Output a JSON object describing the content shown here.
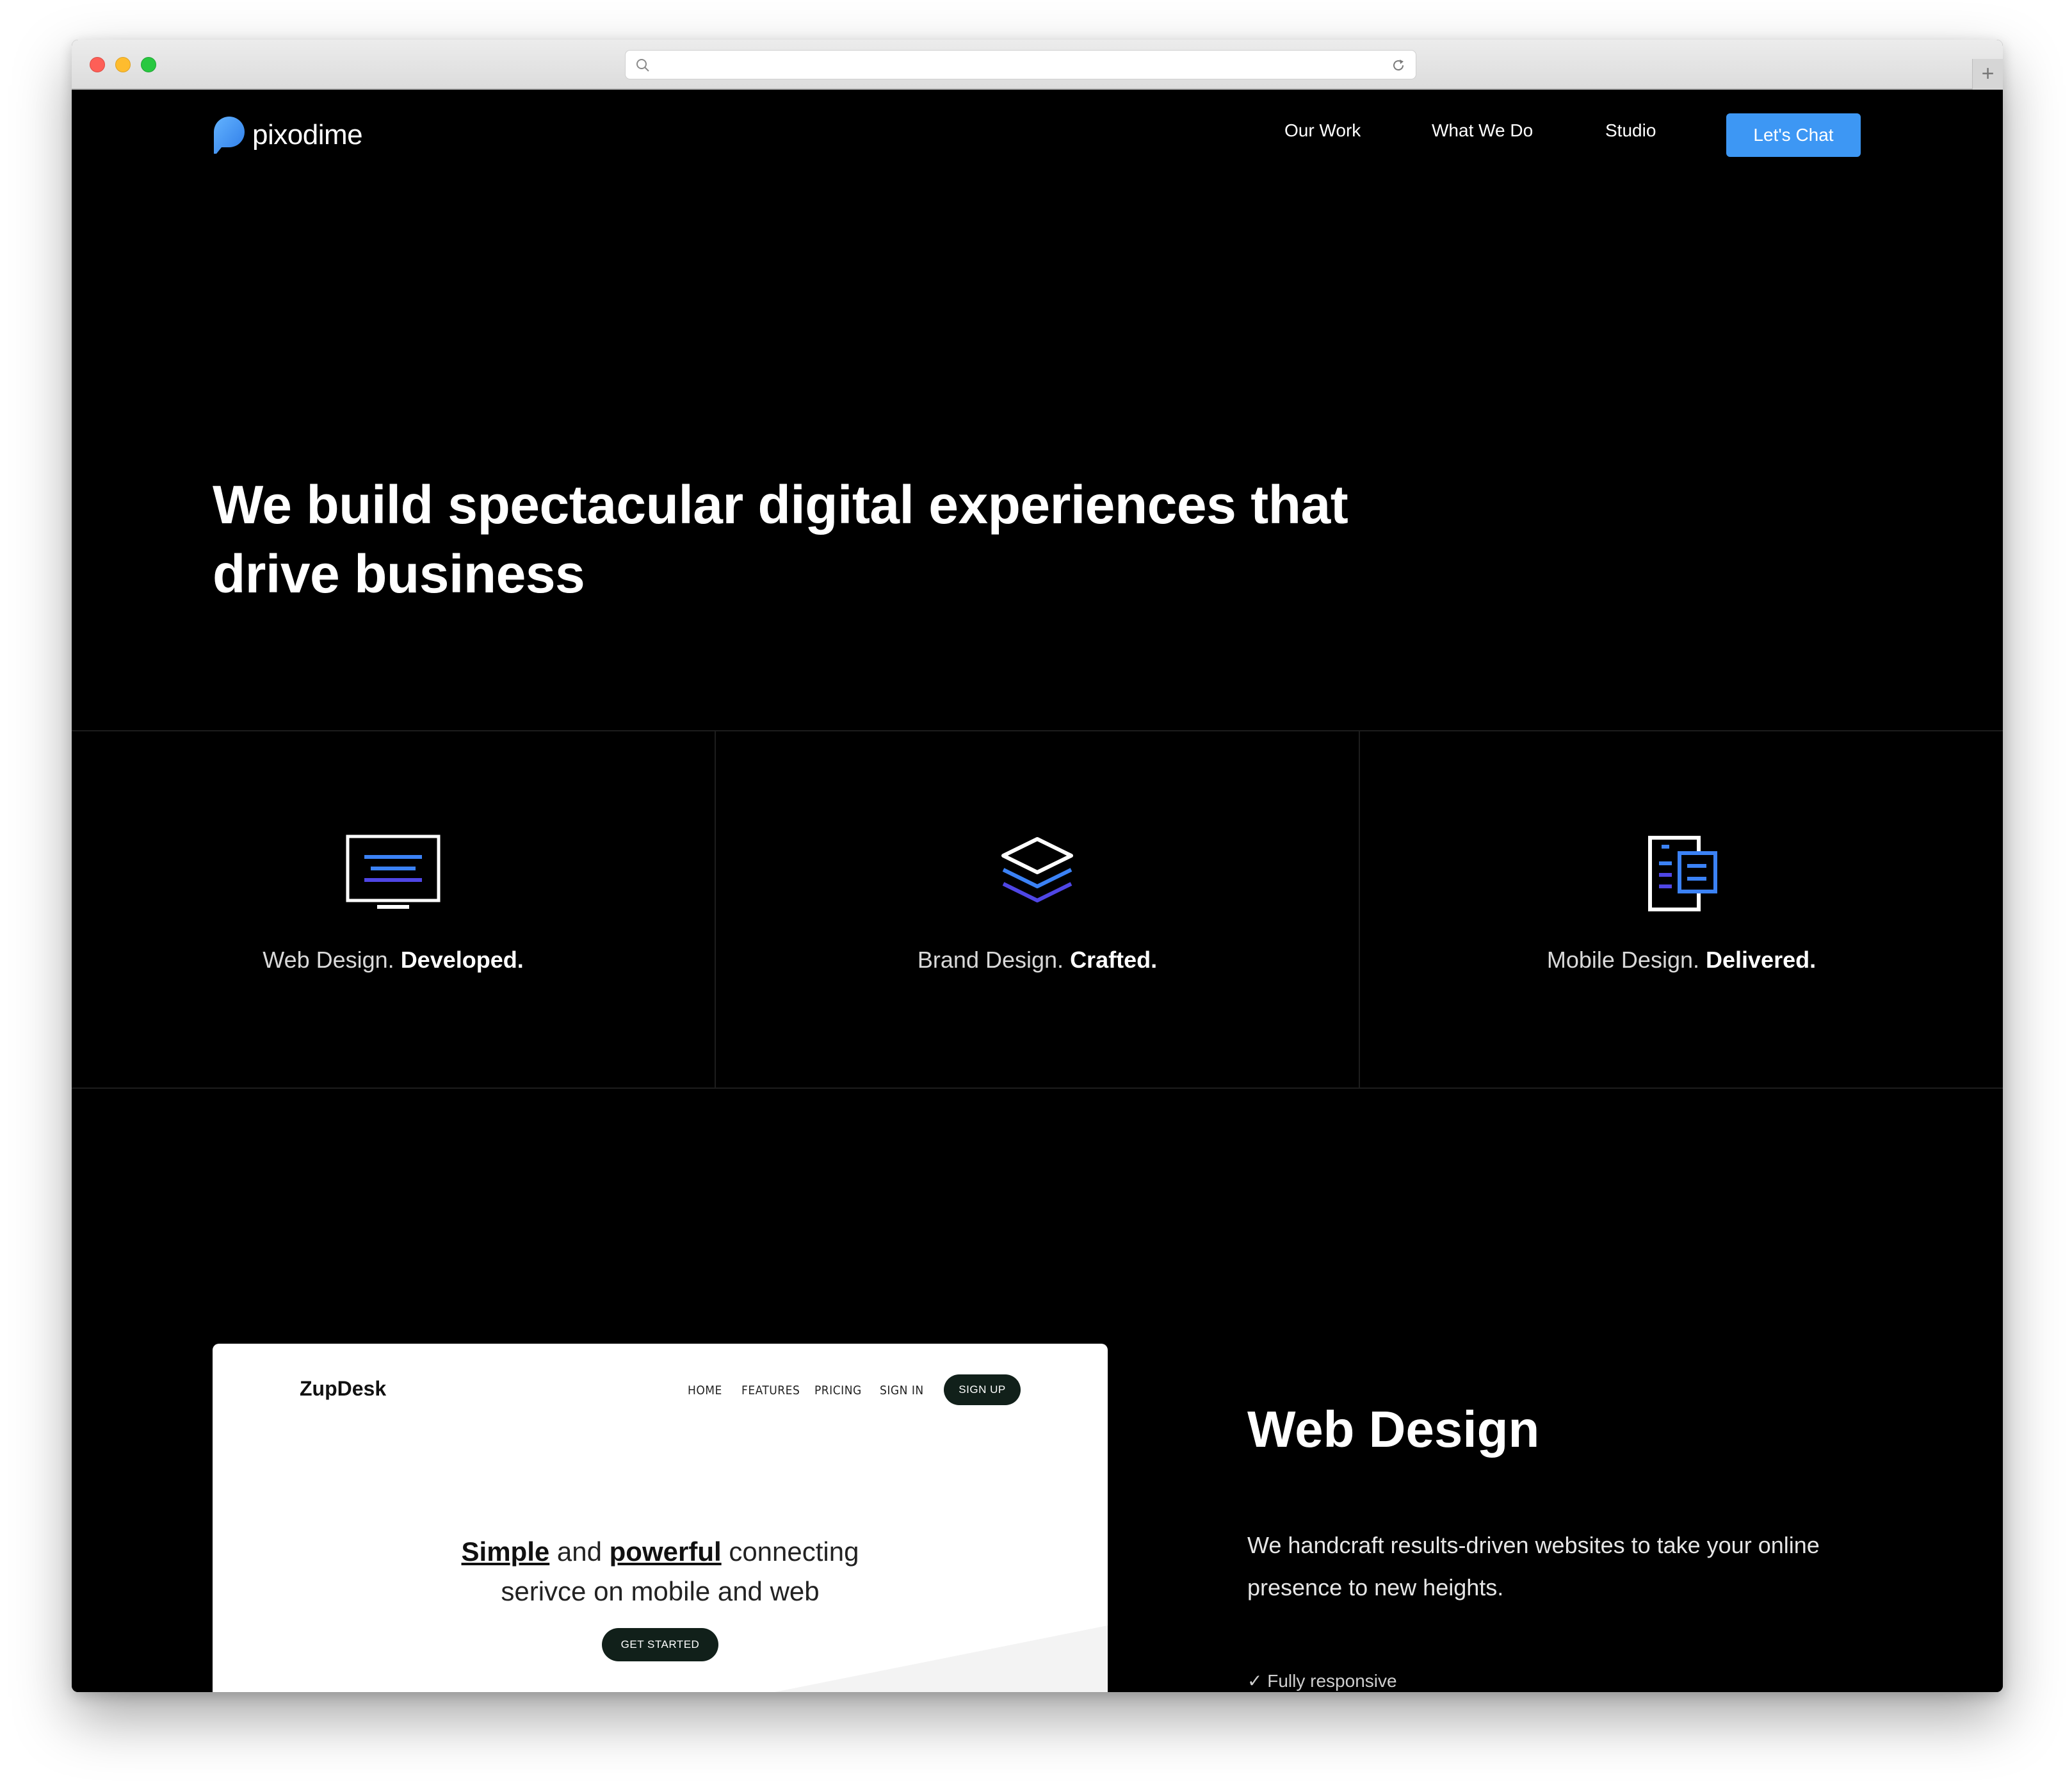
{
  "browser": {
    "address_value": "",
    "new_tab_label": "+"
  },
  "header": {
    "logo_text": "pixodime",
    "nav": [
      "Our Work",
      "What We Do",
      "Studio"
    ],
    "cta_label": "Let's Chat"
  },
  "hero": {
    "title": "We build spectacular digital experiences that drive business"
  },
  "features": [
    {
      "label": "Web Design.",
      "emphasis": "Developed.",
      "icon": "monitor-icon"
    },
    {
      "label": "Brand Design.",
      "emphasis": "Crafted.",
      "icon": "layers-icon"
    },
    {
      "label": "Mobile Design.",
      "emphasis": "Delivered.",
      "icon": "mobile-screens-icon"
    }
  ],
  "mock_site": {
    "logo": "ZupDesk",
    "nav": [
      "HOME",
      "FEATURES",
      "PRICING",
      "SIGN IN"
    ],
    "signup_label": "SIGN UP",
    "headline_word1": "Simple",
    "headline_and": "and",
    "headline_word2": "powerful",
    "headline_rest1": "connecting",
    "headline_line2": "serivce on mobile and web",
    "get_started_label": "GET STARTED"
  },
  "web_design": {
    "title": "Web Design",
    "description": "We handcraft results-driven websites to take your online presence to new heights.",
    "bullet": "Fully responsive"
  },
  "colors": {
    "accent": "#3d97f4",
    "icon_blue": "#3b82f6",
    "icon_indigo": "#4f46e5",
    "page_bg": "#000000"
  }
}
